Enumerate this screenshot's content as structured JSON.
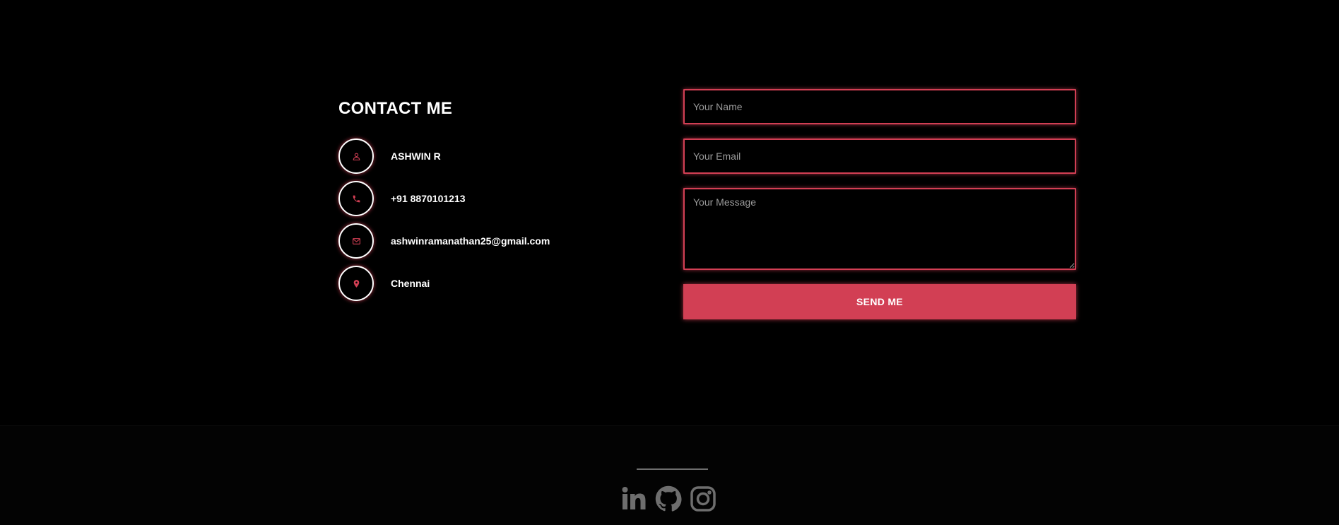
{
  "contact": {
    "title": "CONTACT ME",
    "items": [
      {
        "icon": "user-icon",
        "text": "ASHWIN R"
      },
      {
        "icon": "phone-icon",
        "text": "+91 8870101213"
      },
      {
        "icon": "mail-icon",
        "text": "ashwinramanathan25@gmail.com"
      },
      {
        "icon": "location-pin-icon",
        "text": "Chennai"
      }
    ]
  },
  "form": {
    "name_placeholder": "Your Name",
    "name_value": "",
    "email_placeholder": "Your Email",
    "email_value": "",
    "message_placeholder": "Your Message",
    "message_value": "",
    "submit_label": "SEND ME"
  },
  "footer": {
    "social": [
      {
        "icon": "linkedin-icon"
      },
      {
        "icon": "github-icon"
      },
      {
        "icon": "instagram-icon"
      }
    ]
  },
  "colors": {
    "background": "#000000",
    "accent": "#d23f54",
    "text": "#ffffff",
    "placeholder": "#9a9a9a",
    "social_icon": "#6e6e6e"
  }
}
